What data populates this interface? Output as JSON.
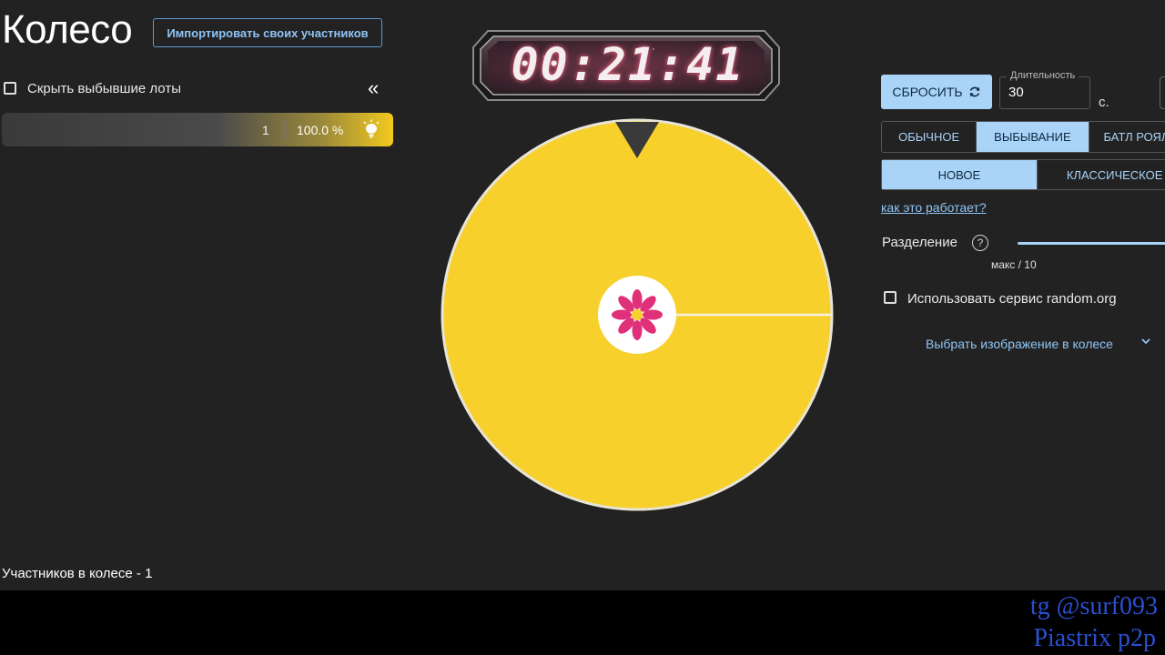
{
  "header": {
    "title": "Колесо",
    "import_button": "Импортировать своих участников"
  },
  "lots": {
    "hide_eliminated_label": "Скрыть выбывшие лоты",
    "collapse_symbol": "«",
    "items": [
      {
        "number": "1",
        "percent": "100.0 %",
        "color": "#f7d02c"
      }
    ],
    "participants_count_label": "Участников в колесе - 1"
  },
  "timer": {
    "value": "00:21:41"
  },
  "wheel": {
    "segment_color": "#f7d02c",
    "center_icon": "flower-icon",
    "pointer_icon": "triangle-pointer-icon"
  },
  "controls": {
    "reset_label": "СБРОСИТЬ",
    "reset_icon": "refresh-icon",
    "duration_label": "Длительность",
    "duration_value": "30",
    "duration_unit": "с.",
    "modes": [
      {
        "label": "ОБЫЧНОЕ",
        "active": false
      },
      {
        "label": "ВЫБЫВАНИЕ",
        "active": true
      },
      {
        "label": "БАТЛ РОЯЛ",
        "active": false
      }
    ],
    "types": [
      {
        "label": "НОВОЕ",
        "active": true
      },
      {
        "label": "КЛАССИЧЕСКОЕ",
        "active": false
      }
    ],
    "how_it_works": "как это работает?",
    "split_label": "Разделение",
    "split_help": "?",
    "split_caption": "макс / 10",
    "random_org_label": "Использовать сервис random.org",
    "image_select_label": "Выбрать изображение в колесе",
    "accent_color": "#a9d3f7"
  },
  "watermark": {
    "line1": "tg @surf093",
    "line2": "Piastrix p2p"
  }
}
